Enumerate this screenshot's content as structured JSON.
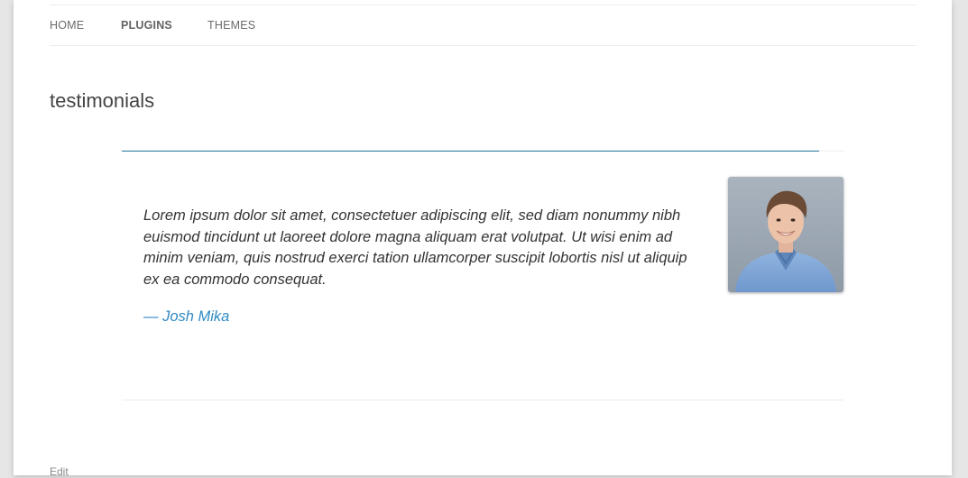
{
  "nav": {
    "items": [
      {
        "label": "HOME"
      },
      {
        "label": "PLUGINS"
      },
      {
        "label": "THEMES"
      }
    ]
  },
  "page": {
    "title": "testimonials",
    "edit_label": "Edit"
  },
  "testimonial": {
    "quote": "Lorem ipsum dolor sit amet, consectetuer adipiscing elit, sed diam nonummy nibh euismod tincidunt ut laoreet dolore magna aliquam erat volutpat. Ut wisi enim ad minim veniam, quis nostrud exerci tation ullamcorper suscipit lobortis nisl ut aliquip ex ea commodo consequat.",
    "author": "— Josh Mika",
    "avatar_icon": "person-photo"
  },
  "colors": {
    "accent": "#21759b",
    "author_link": "#2f8ac4"
  }
}
